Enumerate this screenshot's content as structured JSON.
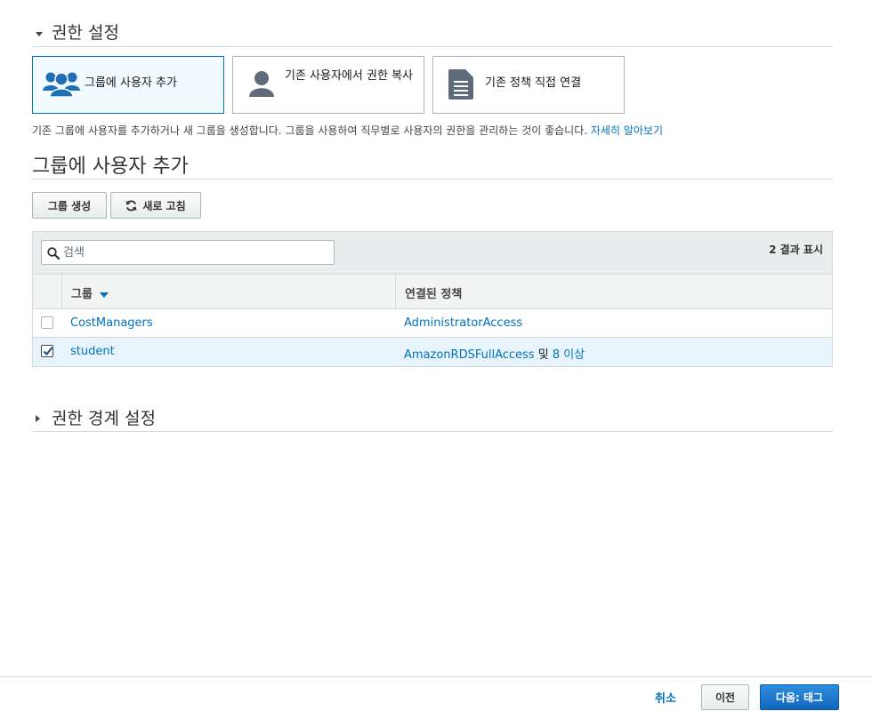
{
  "permissions": {
    "section_title": "권한 설정",
    "options": [
      {
        "label": "그룹에 사용자 추가",
        "icon": "users-group-icon",
        "selected": true
      },
      {
        "label": "기존 사용자에서 권한 복사",
        "icon": "user-icon",
        "selected": false
      },
      {
        "label": "기존 정책 직접 연결",
        "icon": "document-icon",
        "selected": false
      }
    ],
    "description": "기존 그룹에 사용자를 추가하거나 새 그룹을 생성합니다. 그룹을 사용하여 직무별로 사용자의 권한을 관리하는 것이 좋습니다. ",
    "learn_more": "자세히 알아보기"
  },
  "group_section": {
    "title": "그룹에 사용자 추가",
    "create_button": "그룹 생성",
    "refresh_button": "새로 고침"
  },
  "table": {
    "search_placeholder": "검색",
    "result_count": "2 결과 표시",
    "columns": {
      "group": "그룹",
      "policy": "연결된 정책"
    },
    "rows": [
      {
        "checked": false,
        "group": "CostManagers",
        "policy": "AdministratorAccess",
        "and_text": "",
        "more": ""
      },
      {
        "checked": true,
        "group": "student",
        "policy": "AmazonRDSFullAccess",
        "and_text": " 및 ",
        "more": "8 이상"
      }
    ]
  },
  "boundary": {
    "section_title": "권한 경계 설정"
  },
  "footer": {
    "cancel": "취소",
    "previous": "이전",
    "next": "다음: 태그"
  },
  "colors": {
    "link": "#0073bb",
    "primary_button": "#1166bb",
    "selected_row": "#e8f4fb"
  }
}
